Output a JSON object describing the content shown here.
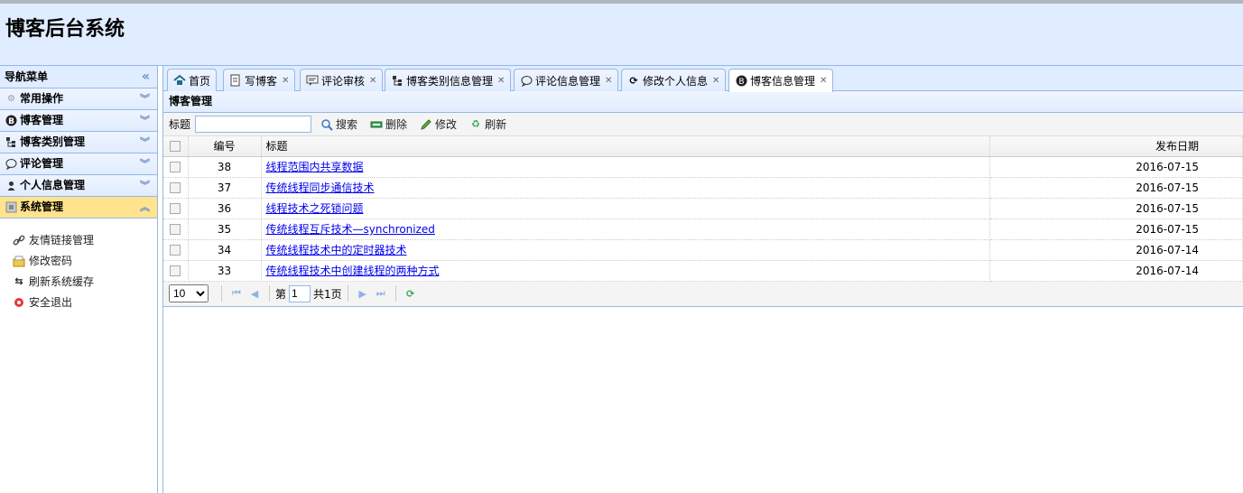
{
  "app": {
    "title": "博客后台系统"
  },
  "nav": {
    "title": "导航菜单",
    "sections": [
      {
        "label": "常用操作"
      },
      {
        "label": "博客管理"
      },
      {
        "label": "博客类别管理"
      },
      {
        "label": "评论管理"
      },
      {
        "label": "个人信息管理"
      },
      {
        "label": "系统管理"
      }
    ],
    "sub_items": [
      {
        "label": "友情链接管理"
      },
      {
        "label": "修改密码"
      },
      {
        "label": "刷新系统缓存"
      },
      {
        "label": "安全退出"
      }
    ]
  },
  "tabs": [
    {
      "label": "首页"
    },
    {
      "label": "写博客"
    },
    {
      "label": "评论审核"
    },
    {
      "label": "博客类别信息管理"
    },
    {
      "label": "评论信息管理"
    },
    {
      "label": "修改个人信息"
    },
    {
      "label": "博客信息管理"
    }
  ],
  "panel": {
    "title": "博客管理"
  },
  "toolbar": {
    "title_label": "标题",
    "title_value": "",
    "search": "搜索",
    "delete": "删除",
    "edit": "修改",
    "refresh": "刷新"
  },
  "grid": {
    "headers": {
      "id": "编号",
      "title": "标题",
      "date": "发布日期"
    },
    "rows": [
      {
        "id": "38",
        "title": "线程范围内共享数据",
        "date": "2016-07-15"
      },
      {
        "id": "37",
        "title": "传统线程同步通信技术",
        "date": "2016-07-15"
      },
      {
        "id": "36",
        "title": "线程技术之死锁问题",
        "date": "2016-07-15"
      },
      {
        "id": "35",
        "title": "传统线程互斥技术—synchronized",
        "date": "2016-07-15"
      },
      {
        "id": "34",
        "title": "传统线程技术中的定时器技术",
        "date": "2016-07-14"
      },
      {
        "id": "33",
        "title": "传统线程技术中创建线程的两种方式",
        "date": "2016-07-14"
      }
    ]
  },
  "pager": {
    "page_size": "10",
    "page_prefix": "第",
    "page_number": "1",
    "page_total": "共1页"
  },
  "colors": {
    "accent": "#95B8E7",
    "header_bg": "#E0ECFF",
    "active_section": "#FFE48D",
    "link": "#0000EE"
  }
}
